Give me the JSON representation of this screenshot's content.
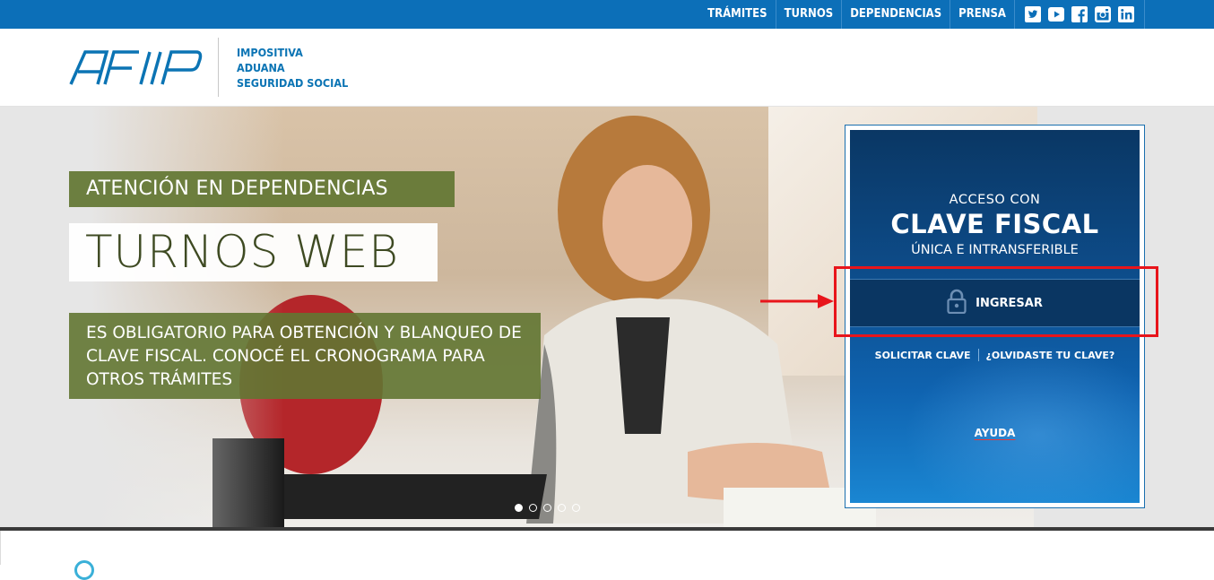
{
  "topnav": {
    "items": [
      "TRÁMITES",
      "TURNOS",
      "DEPENDENCIAS",
      "PRENSA"
    ],
    "social": [
      "twitter-icon",
      "youtube-icon",
      "facebook-icon",
      "instagram-icon",
      "linkedin-icon"
    ]
  },
  "header": {
    "logo": "AFIP",
    "links": [
      "IMPOSITIVA",
      "ADUANA",
      "SEGURIDAD SOCIAL"
    ]
  },
  "hero": {
    "banner_top": "ATENCIÓN EN DEPENDENCIAS",
    "banner_title": "TURNOS WEB",
    "banner_desc": "ES OBLIGATORIO PARA OBTENCIÓN Y BLANQUEO DE CLAVE FISCAL. CONOCÉ EL CRONOGRAMA PARA OTROS TRÁMITES",
    "dots_active_index": 0
  },
  "login": {
    "acceso": "ACCESO CON",
    "clave": "CLAVE FISCAL",
    "unica": "ÚNICA E INTRANSFERIBLE",
    "ingresar": "INGRESAR",
    "solicitar": "SOLICITAR CLAVE",
    "olvidaste": "¿OLVIDASTE TU CLAVE?",
    "ayuda": "AYUDA"
  },
  "colors": {
    "primary_blue": "#0c6fb8",
    "olive_banner": "#627632",
    "annotation_red": "#e8151b"
  }
}
